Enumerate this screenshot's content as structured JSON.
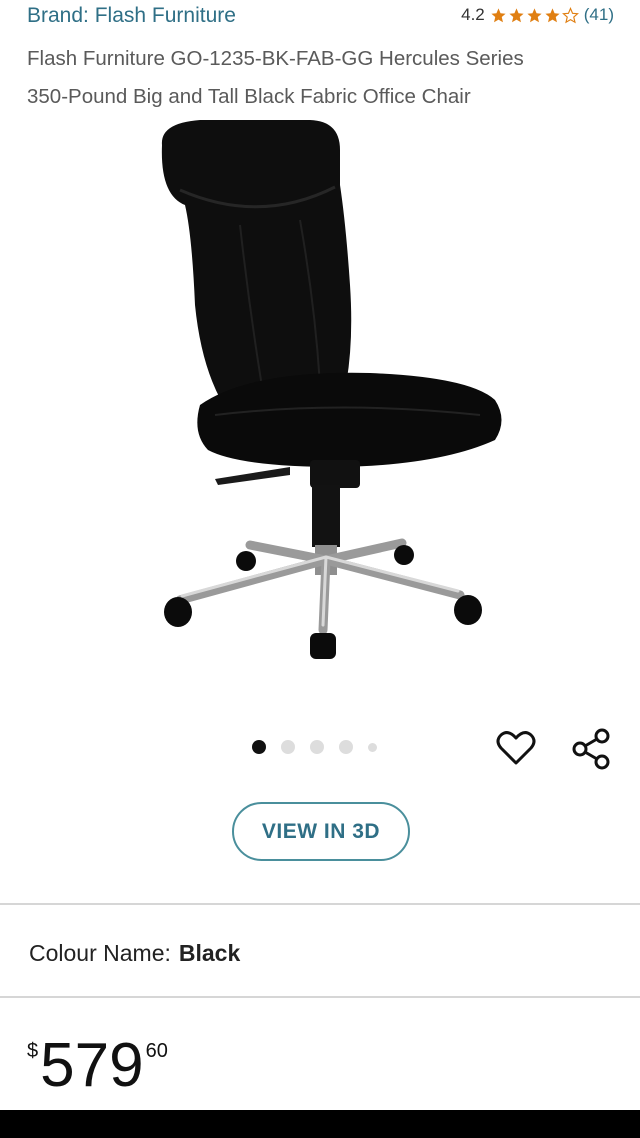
{
  "brand_label": "Brand: Flash Furniture",
  "rating": {
    "value": "4.2",
    "stars": 4.2,
    "count": "(41)",
    "star_color": "#e07f12"
  },
  "title_line1": "Flash Furniture GO-1235-BK-FAB-GG Hercules Series",
  "title_line2": "350-Pound Big and Tall Black Fabric Office Chair",
  "image": {
    "description_icon": "chair-image",
    "total_images": 5,
    "active_index": 0
  },
  "icons": {
    "wishlist": "heart-icon",
    "share": "share-icon"
  },
  "view3d_label": "VIEW IN 3D",
  "colour": {
    "label": "Colour Name:",
    "value": "Black"
  },
  "price": {
    "currency": "$",
    "whole": "579",
    "fraction": "60"
  },
  "colors": {
    "link": "#2f6f86",
    "accent": "#4a8f9c",
    "star": "#e07f12"
  }
}
